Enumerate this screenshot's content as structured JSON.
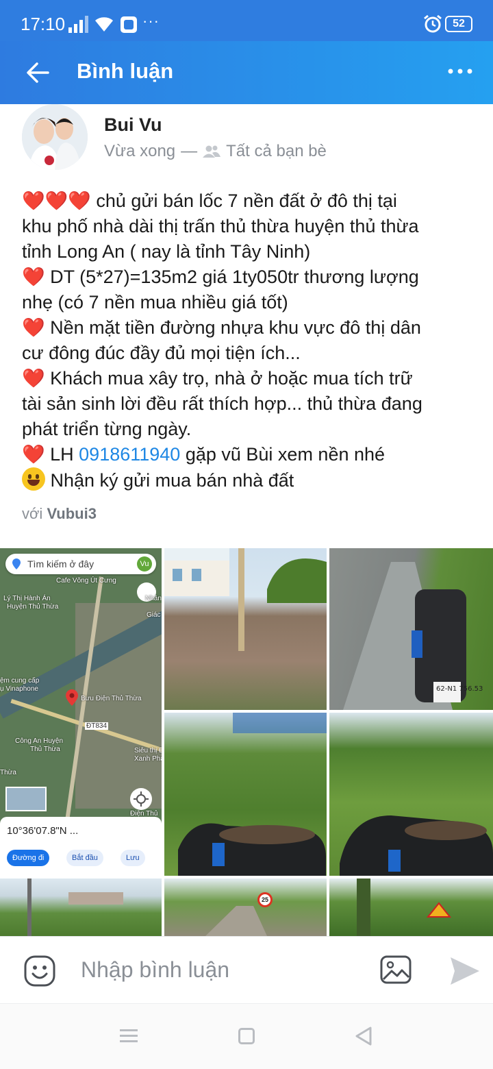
{
  "status_bar": {
    "time": "17:10",
    "more": "···",
    "battery": "52"
  },
  "header": {
    "title": "Bình luận"
  },
  "post": {
    "author": "Bui Vu",
    "time": "Vừa xong",
    "separator": "—",
    "audience": "Tất cả bạn bè",
    "lines": {
      "l1_hearts": "❤️❤️❤️",
      "l1": " chủ gửi bán lốc 7 nền đất ở đô thị tại",
      "l2": "khu phố nhà dài thị trấn thủ thừa huyện thủ thừa",
      "l3": "tỉnh Long An ( nay là tỉnh Tây Ninh)",
      "l4_heart": "❤️",
      "l4": " DT (5*27)=135m2 giá 1ty050tr thương lượng",
      "l5": "nhẹ (có 7 nền mua nhiều giá tốt)",
      "l6_heart": "❤️",
      "l6": " Nền mặt tiền đường nhựa khu vực đô thị dân",
      "l7": "cư đông đúc đầy đủ mọi tiện ích...",
      "l8_heart": "❤️",
      "l8": " Khách mua xây trọ, nhà ở hoặc mua tích trữ",
      "l9": "tài sản sinh lời đều rất thích hợp... thủ thừa đang",
      "l10": "phát triển từng ngày.",
      "l11_heart": "❤️",
      "l11_prefix": " LH ",
      "l11_phone": "0918611940",
      "l11_suffix": " gặp vũ Bùi xem nền nhé",
      "l12": " Nhận ký gửi mua bán nhà đất"
    },
    "with_prefix": "với ",
    "with_name": "Vubui3"
  },
  "map": {
    "search_placeholder": "Tìm kiếm ở đây",
    "avatar_text": "Vu",
    "labels": {
      "cafe": "Cafe Võng Út Cưng",
      "ly_thi": "Lý Thị Hành Án",
      "huyen": "Huyện Thủ Thừa",
      "cung_cap": "ệm cung cấp",
      "vinaphone": "ụ Vinaphone",
      "buu_dien": "Bưu Điện Thủ Thừa",
      "road_code": "ĐT834",
      "cong_an": "Công An Huyện",
      "cong_an2": "Thủ Thừa",
      "sieu_thi": "Siêu thị Đ",
      "xanh": "Xanh Phan V",
      "dien_thu": "Điện Thủ",
      "thua": "Thừa",
      "giac": "Giác",
      "nhan": "Nhân"
    },
    "coordinate": "10°36'07.8\"N ...",
    "chips": {
      "directions": "Đường đi",
      "start": "Bắt đầu",
      "save": "Lưu"
    }
  },
  "photos": {
    "plate": "62-N1 756.53",
    "speed_sign": "25"
  },
  "comment_bar": {
    "placeholder": "Nhập bình luận"
  }
}
